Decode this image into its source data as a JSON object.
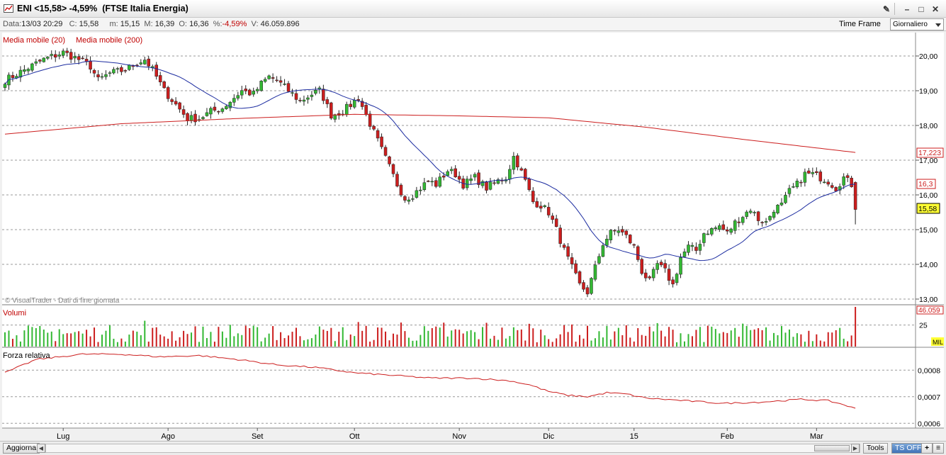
{
  "window": {
    "title": "ENI <15,58> -4,59%  (FTSE Italia Energia)",
    "controls": [
      "pin",
      "minimize",
      "maximize",
      "close"
    ]
  },
  "infobar": {
    "data_label": "Data:",
    "data_value": "13/03 20:29",
    "c_label": "C:",
    "c_value": "15,58",
    "m_label": "m:",
    "m_value": "15,15",
    "M_label": "M:",
    "M_value": "16,39",
    "o_label": "O:",
    "o_value": "16,36",
    "pct_label": "%:",
    "pct_value": "-4,59%",
    "v_label": "V:",
    "v_value": "46.059.896",
    "time_frame_label": "Time Frame",
    "time_frame_value": "Giornaliero"
  },
  "legend": {
    "ma20": "Media mobile (20)",
    "ma200": "Media mobile (200)",
    "watermark": "© VisualTrader - Dati di fine giornata",
    "volumes": "Volumi",
    "rs": "Forza relativa"
  },
  "colors": {
    "up": "#33b833",
    "down": "#cc1e1e",
    "ma20": "#1c2ca0",
    "ma200": "#cc1e1e",
    "rs": "#cc1e1e",
    "last_price_bg": "#ffff33"
  },
  "price_axis": {
    "ticks": [
      "20,00",
      "19,00",
      "18,00",
      "17,00",
      "16,00",
      "15,00",
      "14,00",
      "13,00"
    ],
    "ma200_label": "17,223",
    "ma20_label": "16,3",
    "last_label": "15,58"
  },
  "volume_axis": {
    "ticks": [
      "25"
    ],
    "top_label": "46.059",
    "unit": "MIL"
  },
  "rs_axis": {
    "ticks": [
      "0,0008",
      "0,0007",
      "0,0006"
    ]
  },
  "time_axis": [
    "Lug",
    "Ago",
    "Set",
    "Ott",
    "Nov",
    "Dic",
    "15",
    "Feb",
    "Mar"
  ],
  "chart_data": {
    "type": "candlestick",
    "title": "ENI <15,58> -4,59%  (FTSE Italia Energia)",
    "y_range": [
      13.0,
      20.5
    ],
    "x_labels": [
      "Lug",
      "Ago",
      "Set",
      "Ott",
      "Nov",
      "Dic",
      "15",
      "Feb",
      "Mar"
    ],
    "series": [
      {
        "name": "Media mobile (20)",
        "last": 16.3
      },
      {
        "name": "Media mobile (200)",
        "last": 17.223
      },
      {
        "name": "Volumi",
        "unit": "MIL",
        "last": 46.059
      },
      {
        "name": "Forza relativa",
        "ticks": [
          0.0008,
          0.0007,
          0.0006
        ]
      }
    ],
    "close_anchors": [
      [
        0,
        19.3
      ],
      [
        5,
        19.6
      ],
      [
        10,
        19.9
      ],
      [
        15,
        20.1
      ],
      [
        19,
        19.9
      ],
      [
        22,
        19.7
      ],
      [
        24,
        19.3
      ],
      [
        27,
        19.5
      ],
      [
        31,
        19.6
      ],
      [
        34,
        19.8
      ],
      [
        36,
        19.9
      ],
      [
        38,
        19.6
      ],
      [
        41,
        19.0
      ],
      [
        44,
        18.6
      ],
      [
        47,
        18.2
      ],
      [
        50,
        18.2
      ],
      [
        53,
        18.4
      ],
      [
        56,
        18.5
      ],
      [
        58,
        18.7
      ],
      [
        61,
        19.0
      ],
      [
        64,
        18.9
      ],
      [
        66,
        19.2
      ],
      [
        68,
        19.4
      ],
      [
        70,
        19.3
      ],
      [
        73,
        19.0
      ],
      [
        76,
        18.7
      ],
      [
        79,
        18.9
      ],
      [
        81,
        19.0
      ],
      [
        82,
        18.8
      ],
      [
        84,
        18.3
      ],
      [
        87,
        18.4
      ],
      [
        89,
        18.6
      ],
      [
        91,
        18.8
      ],
      [
        93,
        18.3
      ],
      [
        95,
        17.8
      ],
      [
        97,
        17.3
      ],
      [
        99,
        16.8
      ],
      [
        101,
        16.3
      ],
      [
        103,
        15.9
      ],
      [
        105,
        16.0
      ],
      [
        107,
        16.2
      ],
      [
        109,
        16.4
      ],
      [
        111,
        16.3
      ],
      [
        114,
        16.7
      ],
      [
        116,
        16.6
      ],
      [
        118,
        16.3
      ],
      [
        121,
        16.5
      ],
      [
        124,
        16.2
      ],
      [
        127,
        16.4
      ],
      [
        129,
        16.5
      ],
      [
        131,
        17.1
      ],
      [
        132,
        16.9
      ],
      [
        134,
        16.4
      ],
      [
        136,
        15.8
      ],
      [
        138,
        15.7
      ],
      [
        140,
        15.5
      ],
      [
        142,
        15.0
      ],
      [
        144,
        14.4
      ],
      [
        146,
        13.9
      ],
      [
        148,
        13.4
      ],
      [
        150,
        13.2
      ],
      [
        152,
        13.9
      ],
      [
        154,
        14.6
      ],
      [
        156,
        14.9
      ],
      [
        158,
        15.0
      ],
      [
        160,
        14.8
      ],
      [
        162,
        14.5
      ],
      [
        164,
        13.8
      ],
      [
        166,
        13.5
      ],
      [
        168,
        14.0
      ],
      [
        170,
        13.8
      ],
      [
        172,
        13.4
      ],
      [
        174,
        14.2
      ],
      [
        176,
        14.5
      ],
      [
        178,
        14.4
      ],
      [
        180,
        14.9
      ],
      [
        182,
        15.0
      ],
      [
        184,
        15.1
      ],
      [
        186,
        14.9
      ],
      [
        188,
        15.2
      ],
      [
        190,
        15.4
      ],
      [
        192,
        15.6
      ],
      [
        194,
        15.3
      ],
      [
        196,
        15.2
      ],
      [
        198,
        15.6
      ],
      [
        200,
        15.7
      ],
      [
        202,
        16.1
      ],
      [
        204,
        16.3
      ],
      [
        206,
        16.6
      ],
      [
        208,
        16.6
      ],
      [
        210,
        16.5
      ],
      [
        212,
        16.4
      ],
      [
        214,
        16.2
      ],
      [
        216,
        16.5
      ],
      [
        218,
        16.3
      ],
      [
        219,
        15.58
      ]
    ],
    "ma200_anchors": [
      [
        0,
        17.75
      ],
      [
        30,
        18.05
      ],
      [
        60,
        18.2
      ],
      [
        90,
        18.32
      ],
      [
        115,
        18.28
      ],
      [
        140,
        18.22
      ],
      [
        165,
        17.95
      ],
      [
        190,
        17.6
      ],
      [
        219,
        17.223
      ]
    ],
    "rs_anchors": [
      [
        0,
        0.00079
      ],
      [
        8,
        0.00084
      ],
      [
        20,
        0.00086
      ],
      [
        30,
        0.00086
      ],
      [
        40,
        0.00085
      ],
      [
        50,
        0.000855
      ],
      [
        60,
        0.00084
      ],
      [
        70,
        0.00082
      ],
      [
        80,
        0.00081
      ],
      [
        90,
        0.00079
      ],
      [
        100,
        0.00078
      ],
      [
        110,
        0.00077
      ],
      [
        120,
        0.00077
      ],
      [
        130,
        0.00076
      ],
      [
        135,
        0.000745
      ],
      [
        140,
        0.00072
      ],
      [
        145,
        0.000705
      ],
      [
        150,
        0.0007
      ],
      [
        155,
        0.000715
      ],
      [
        160,
        0.00071
      ],
      [
        165,
        0.000695
      ],
      [
        175,
        0.000685
      ],
      [
        185,
        0.000675
      ],
      [
        195,
        0.00068
      ],
      [
        205,
        0.00069
      ],
      [
        212,
        0.000685
      ],
      [
        216,
        0.00067
      ],
      [
        219,
        0.000655
      ]
    ],
    "volume_ylim": [
      0,
      46.059
    ]
  }
}
